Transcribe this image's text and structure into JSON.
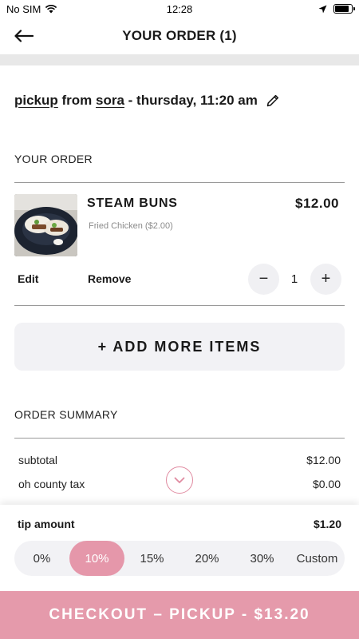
{
  "status_bar": {
    "carrier": "No SIM",
    "time": "12:28",
    "battery_level": 0.9
  },
  "header": {
    "title": "YOUR ORDER (1)"
  },
  "pickup": {
    "mode": "pickup",
    "from": " from ",
    "restaurant": "sora",
    "when": " - thursday, 11:20 am"
  },
  "order_section": {
    "title": "YOUR ORDER"
  },
  "item": {
    "name": "STEAM BUNS",
    "option": "Fried Chicken ($2.00)",
    "price": "$12.00",
    "edit_label": "Edit",
    "remove_label": "Remove",
    "quantity": "1",
    "decrement": "−",
    "increment": "+"
  },
  "add_more_label": "+ ADD MORE ITEMS",
  "summary": {
    "title": "ORDER SUMMARY",
    "rows": [
      {
        "label": "subtotal",
        "value": "$12.00"
      },
      {
        "label": "oh county tax",
        "value": "$0.00"
      }
    ]
  },
  "tip": {
    "title": "tip amount",
    "value": "$1.20",
    "options": [
      "0%",
      "10%",
      "15%",
      "20%",
      "30%",
      "Custom"
    ],
    "selected": "10%"
  },
  "checkout_label": "CHECKOUT – PICKUP - $13.20",
  "colors": {
    "accent": "#e597aa",
    "checkout": "#e59aab",
    "surface": "#f2f2f5"
  }
}
